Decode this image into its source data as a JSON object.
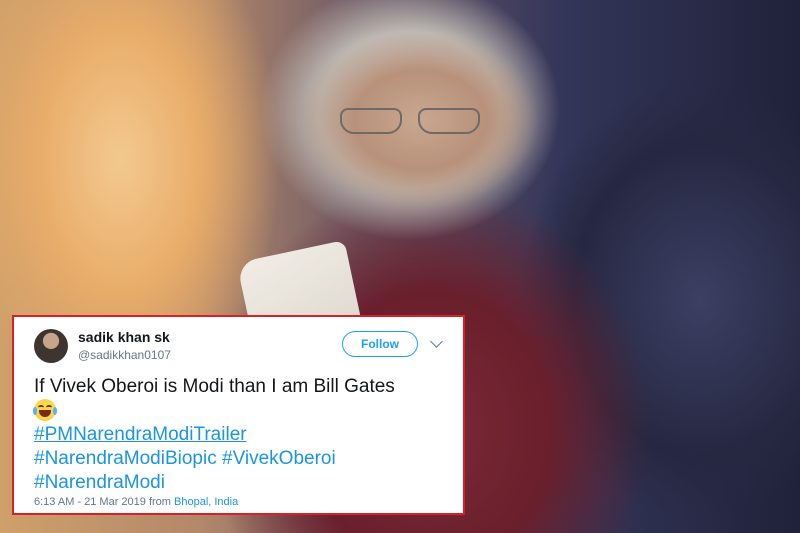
{
  "tweet": {
    "name": "sadik khan sk",
    "handle": "@sadikkhan0107",
    "follow_label": "Follow",
    "text": "If Vivek Oberoi is Modi than I am Bill Gates",
    "emoji": "face-with-tears-of-joy-icon",
    "hashtags": [
      "#PMNarendraModiTrailer",
      "#NarendraModiBiopic",
      "#VivekOberoi",
      "#NarendraModi"
    ],
    "timestamp": "6:13 AM - 21 Mar 2019 from",
    "location": "Bhopal, India"
  },
  "colors": {
    "accent": "#1da1f2",
    "link": "#1b95e0",
    "border": "#d82027",
    "text": "#14171a",
    "muted": "#657786"
  }
}
